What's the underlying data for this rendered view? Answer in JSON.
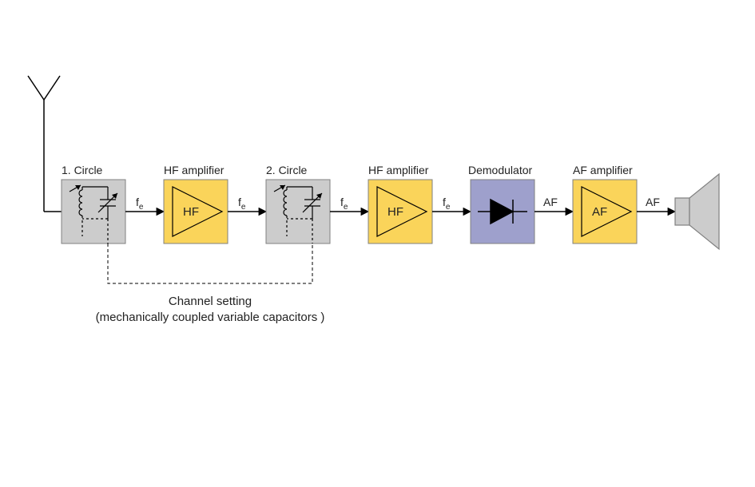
{
  "labels": {
    "circle1": "1. Circle",
    "hf1": "HF amplifier",
    "circle2": "2. Circle",
    "hf2": "HF amplifier",
    "demod": "Demodulator",
    "af": "AF amplifier"
  },
  "amp_text": {
    "hf": "HF",
    "af": "AF"
  },
  "signals": {
    "fe": "f",
    "fe_sub": "e",
    "af": "AF"
  },
  "caption": {
    "line1": "Channel setting",
    "line2": "(mechanically coupled variable capacitors )"
  },
  "colors": {
    "tuned_fill": "#cccccc",
    "amp_fill": "#fad45a",
    "demod_fill": "#9ea0cc",
    "stroke": "#808080",
    "line": "#000000"
  }
}
